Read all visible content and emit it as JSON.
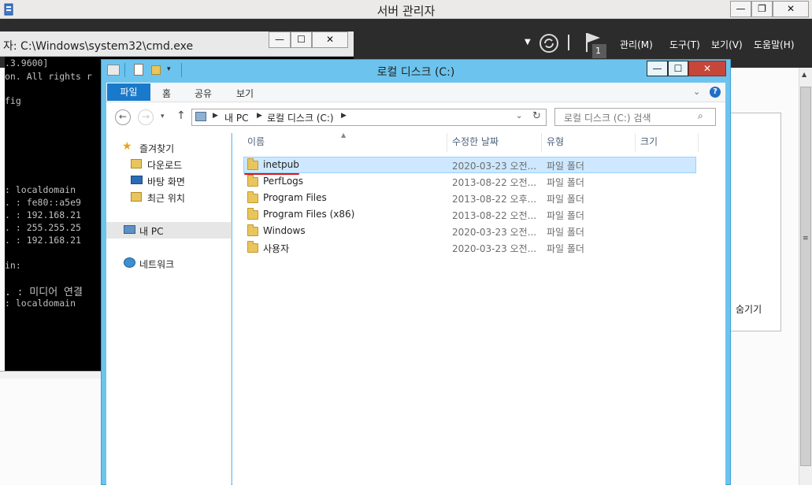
{
  "server_manager": {
    "title": "서버 관리자",
    "menus": [
      "관리(M)",
      "도구(T)",
      "보기(V)",
      "도움말(H)"
    ],
    "notification_count": "1",
    "hide_label": "숨기기"
  },
  "cmd": {
    "title": "자: C:\\Windows\\system32\\cmd.exe",
    "lines": [
      ".3.9600]",
      "on. All rights r",
      "",
      "fig",
      "",
      "",
      "",
      "",
      ": localdomain",
      " . : fe80::a5e9",
      " . : 192.168.21",
      " . : 255.255.25",
      " . : 192.168.21",
      "",
      "in:",
      "",
      " . : 미디어 연결",
      ": localdomain"
    ]
  },
  "explorer": {
    "title": "로컬 디스크 (C:)",
    "ribbon_tabs": [
      "파일",
      "홈",
      "공유",
      "보기"
    ],
    "address": {
      "breadcrumb": [
        "내 PC",
        "로컬 디스크 (C:)"
      ]
    },
    "search_placeholder": "로컬 디스크 (C:) 검색",
    "nav": {
      "favorites": "즐겨찾기",
      "downloads": "다운로드",
      "desktop": "바탕 화면",
      "recent": "최근 위치",
      "this_pc": "내 PC",
      "network": "네트워크"
    },
    "columns": [
      "이름",
      "수정한 날짜",
      "유형",
      "크기"
    ],
    "rows": [
      {
        "name": "inetpub",
        "date": "2020-03-23 오전...",
        "type": "파일 폴더"
      },
      {
        "name": "PerfLogs",
        "date": "2013-08-22 오전...",
        "type": "파일 폴더"
      },
      {
        "name": "Program Files",
        "date": "2013-08-22 오후...",
        "type": "파일 폴더"
      },
      {
        "name": "Program Files (x86)",
        "date": "2013-08-22 오전...",
        "type": "파일 폴더"
      },
      {
        "name": "Windows",
        "date": "2020-03-23 오전...",
        "type": "파일 폴더"
      },
      {
        "name": "사용자",
        "date": "2020-03-23 오전...",
        "type": "파일 폴더"
      }
    ]
  },
  "colors": {
    "explorer_frame": "#6cc4ee",
    "file_tab": "#1979ca",
    "selection": "#cde8ff",
    "annotation_underline": "#d9161a",
    "close_button": "#c7463a"
  }
}
